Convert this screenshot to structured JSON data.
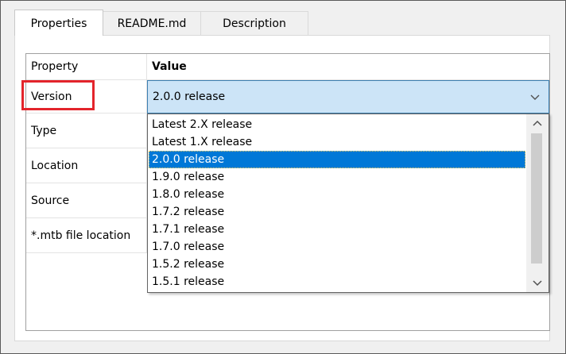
{
  "tabs": [
    "Properties",
    "README.md",
    "Description"
  ],
  "grid": {
    "header": {
      "property": "Property",
      "value": "Value"
    },
    "rows": [
      "Version",
      "Type",
      "Location",
      "Source",
      "*.mtb file location"
    ]
  },
  "version_select": {
    "selected": "2.0.0 release",
    "options": [
      "Latest 2.X release",
      "Latest 1.X release",
      "2.0.0 release",
      "1.9.0 release",
      "1.8.0 release",
      "1.7.2 release",
      "1.7.1 release",
      "1.7.0 release",
      "1.5.2 release",
      "1.5.1 release"
    ],
    "selected_index": 2
  },
  "colors": {
    "selection": "#0078d7",
    "highlight_box": "#e3242b",
    "combo_bg": "#cce4f7"
  },
  "icons": [
    "chevron-down-icon",
    "scroll-up-icon",
    "scroll-down-icon"
  ]
}
